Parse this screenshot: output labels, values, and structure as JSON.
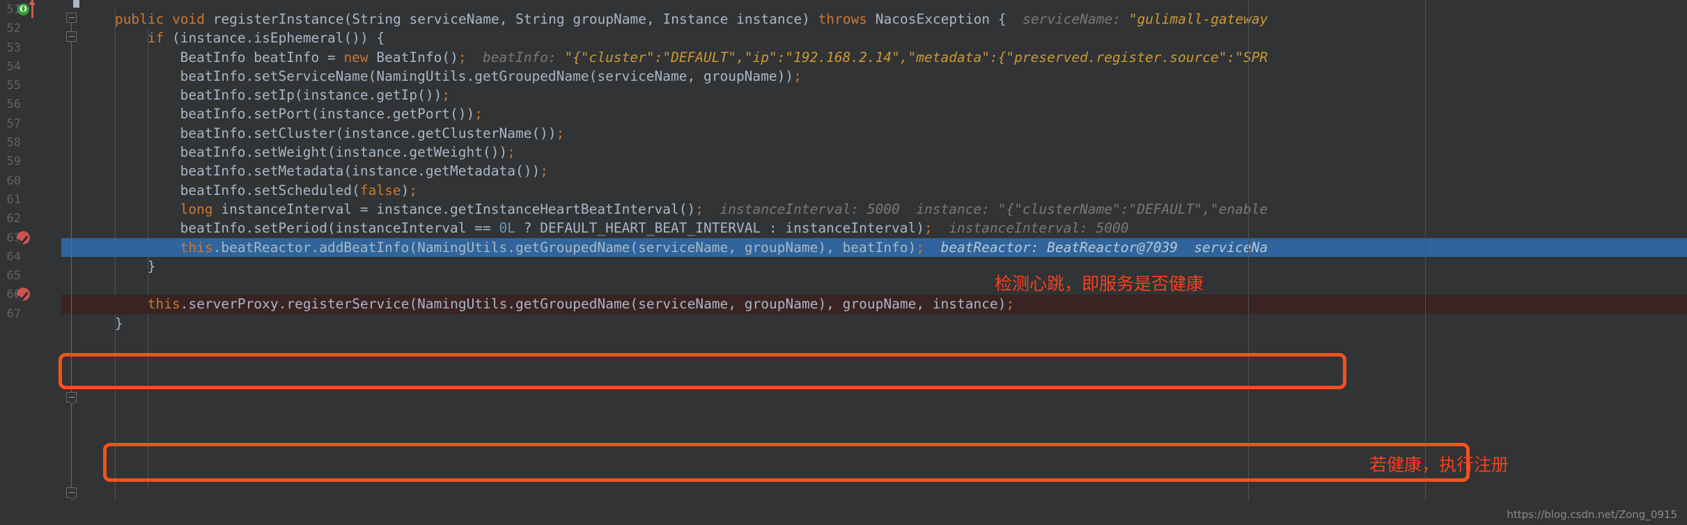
{
  "editor": {
    "theme_background": "#313335",
    "selection_color": "#2f659c",
    "breakpoint_line_color": "#3a2323",
    "annotation_color": "#f4411e",
    "keyword_color": "#cc7832",
    "identifier_color": "#a9b7c6",
    "number_color": "#6897bb",
    "hint_color": "#787878",
    "hint_string_color": "#cc9933"
  },
  "gutter": {
    "lines": [
      {
        "number": "51",
        "icon": "override-method-icon",
        "secondary_icon": "red-up-arrow-icon"
      },
      {
        "number": "52",
        "icon": ""
      },
      {
        "number": "53",
        "icon": ""
      },
      {
        "number": "54",
        "icon": ""
      },
      {
        "number": "55",
        "icon": ""
      },
      {
        "number": "56",
        "icon": ""
      },
      {
        "number": "57",
        "icon": ""
      },
      {
        "number": "58",
        "icon": ""
      },
      {
        "number": "59",
        "icon": ""
      },
      {
        "number": "60",
        "icon": ""
      },
      {
        "number": "61",
        "icon": ""
      },
      {
        "number": "62",
        "icon": ""
      },
      {
        "number": "63",
        "icon": "breakpoint-verified-icon"
      },
      {
        "number": "64",
        "icon": ""
      },
      {
        "number": "65",
        "icon": ""
      },
      {
        "number": "66",
        "icon": "breakpoint-verified-icon"
      },
      {
        "number": "67",
        "icon": ""
      }
    ]
  },
  "code": {
    "lines": [
      {
        "id": "line-51",
        "indent": 4,
        "tokens": [
          {
            "t": "kw",
            "v": "public"
          },
          {
            "t": "ws",
            "v": " "
          },
          {
            "t": "kw",
            "v": "void"
          },
          {
            "t": "ws",
            "v": " "
          },
          {
            "t": "id",
            "v": "registerInstance(String serviceName, String groupName, Instance instance) "
          },
          {
            "t": "kw",
            "v": "throws"
          },
          {
            "t": "ws",
            "v": " "
          },
          {
            "t": "id",
            "v": "NacosException {"
          },
          {
            "t": "ws",
            "v": "  "
          },
          {
            "t": "hint",
            "v": "serviceName: "
          },
          {
            "t": "hintstr",
            "v": "\"gulimall-gateway"
          }
        ]
      },
      {
        "id": "line-52",
        "indent": 8,
        "tokens": [
          {
            "t": "kw",
            "v": "if"
          },
          {
            "t": "id",
            "v": " (instance.isEphemeral()) {"
          }
        ]
      },
      {
        "id": "line-53",
        "indent": 12,
        "tokens": [
          {
            "t": "id",
            "v": "BeatInfo beatInfo = "
          },
          {
            "t": "kw",
            "v": "new"
          },
          {
            "t": "id",
            "v": " BeatInfo()"
          },
          {
            "t": "semi",
            "v": ";"
          },
          {
            "t": "ws",
            "v": "  "
          },
          {
            "t": "hint",
            "v": "beatInfo: "
          },
          {
            "t": "hintstr",
            "v": "\"{\"cluster\":\"DEFAULT\",\"ip\":\"192.168.2.14\",\"metadata\":{\"preserved.register.source\":\"SPR"
          }
        ]
      },
      {
        "id": "line-54",
        "indent": 12,
        "tokens": [
          {
            "t": "id",
            "v": "beatInfo.setServiceName(NamingUtils.getGroupedName(serviceName, groupName))"
          },
          {
            "t": "semi",
            "v": ";"
          }
        ]
      },
      {
        "id": "line-55",
        "indent": 12,
        "tokens": [
          {
            "t": "id",
            "v": "beatInfo.setIp(instance.getIp())"
          },
          {
            "t": "semi",
            "v": ";"
          }
        ]
      },
      {
        "id": "line-56",
        "indent": 12,
        "tokens": [
          {
            "t": "id",
            "v": "beatInfo.setPort(instance.getPort())"
          },
          {
            "t": "semi",
            "v": ";"
          }
        ]
      },
      {
        "id": "line-57",
        "indent": 12,
        "tokens": [
          {
            "t": "id",
            "v": "beatInfo.setCluster(instance.getClusterName())"
          },
          {
            "t": "semi",
            "v": ";"
          }
        ]
      },
      {
        "id": "line-58",
        "indent": 12,
        "tokens": [
          {
            "t": "id",
            "v": "beatInfo.setWeight(instance.getWeight())"
          },
          {
            "t": "semi",
            "v": ";"
          }
        ]
      },
      {
        "id": "line-59",
        "indent": 12,
        "tokens": [
          {
            "t": "id",
            "v": "beatInfo.setMetadata(instance.getMetadata())"
          },
          {
            "t": "semi",
            "v": ";"
          }
        ]
      },
      {
        "id": "line-60",
        "indent": 12,
        "tokens": [
          {
            "t": "id",
            "v": "beatInfo.setScheduled("
          },
          {
            "t": "kw",
            "v": "false"
          },
          {
            "t": "id",
            "v": ")"
          },
          {
            "t": "semi",
            "v": ";"
          }
        ]
      },
      {
        "id": "line-61",
        "indent": 12,
        "tokens": [
          {
            "t": "kw",
            "v": "long"
          },
          {
            "t": "id",
            "v": " instanceInterval = instance.getInstanceHeartBeatInterval()"
          },
          {
            "t": "semi",
            "v": ";"
          },
          {
            "t": "ws",
            "v": "  "
          },
          {
            "t": "hint",
            "v": "instanceInterval: 5000"
          },
          {
            "t": "ws",
            "v": "  "
          },
          {
            "t": "hint",
            "v": "instance: "
          },
          {
            "t": "hint",
            "v": "\"{\"clusterName\":\"DEFAULT\",\"enable"
          }
        ]
      },
      {
        "id": "line-62",
        "indent": 12,
        "tokens": [
          {
            "t": "id",
            "v": "beatInfo.setPeriod(instanceInterval == "
          },
          {
            "t": "num",
            "v": "0L"
          },
          {
            "t": "id",
            "v": " ? DEFAULT_HEART_BEAT_INTERVAL : instanceInterval)"
          },
          {
            "t": "semi",
            "v": ";"
          },
          {
            "t": "ws",
            "v": "  "
          },
          {
            "t": "hint",
            "v": "instanceInterval: 5000"
          }
        ]
      },
      {
        "id": "line-63",
        "indent": 12,
        "highlight": "selected",
        "tokens": [
          {
            "t": "kw",
            "v": "this"
          },
          {
            "t": "id",
            "v": ".beatReactor.addBeatInfo(NamingUtils.getGroupedName(serviceName, groupName), beatInfo)"
          },
          {
            "t": "semi",
            "v": ";"
          },
          {
            "t": "ws",
            "v": "  "
          },
          {
            "t": "hint",
            "v": "beatReactor: BeatReactor@7039"
          },
          {
            "t": "ws",
            "v": "  "
          },
          {
            "t": "hint",
            "v": "serviceNa"
          }
        ]
      },
      {
        "id": "line-64",
        "indent": 8,
        "tokens": [
          {
            "t": "id",
            "v": "}"
          }
        ]
      },
      {
        "id": "line-65",
        "indent": 0,
        "tokens": []
      },
      {
        "id": "line-66",
        "indent": 8,
        "highlight": "breakpoint",
        "tokens": [
          {
            "t": "kw",
            "v": "this"
          },
          {
            "t": "id",
            "v": ".serverProxy.registerService(NamingUtils.getGroupedName(serviceName, groupName), groupName, instance)"
          },
          {
            "t": "semi",
            "v": ";"
          }
        ]
      },
      {
        "id": "line-67",
        "indent": 4,
        "tokens": [
          {
            "t": "id",
            "v": "}"
          }
        ]
      }
    ]
  },
  "annotations": [
    {
      "id": "annot-heartbeat",
      "text": "检测心跳，即服务是否健康",
      "color": "#f4411e"
    },
    {
      "id": "annot-register",
      "text": "若健康，执行注册",
      "color": "#f4411e"
    }
  ],
  "callout_boxes": [
    {
      "id": "redbox-heartbeat",
      "target_line": "63",
      "color": "#f4511e"
    },
    {
      "id": "redbox-register",
      "target_line": "66",
      "color": "#f4511e"
    }
  ],
  "watermark": {
    "text": "https://blog.csdn.net/Zong_0915"
  }
}
